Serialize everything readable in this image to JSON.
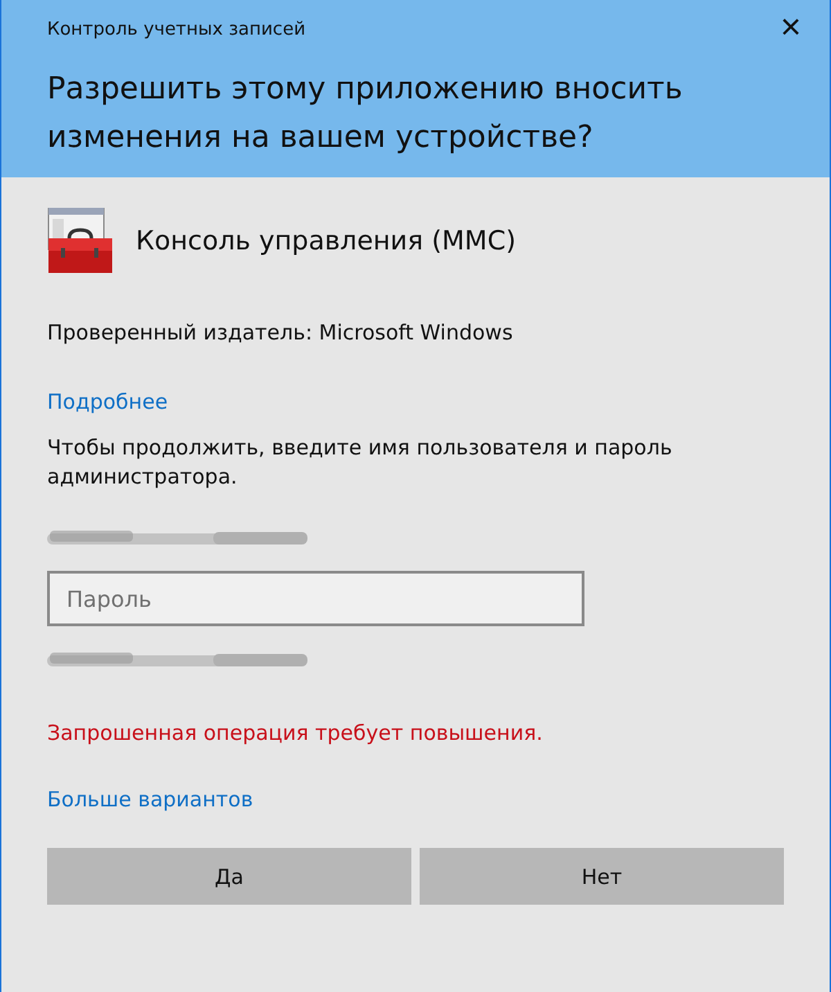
{
  "window": {
    "title": "Контроль учетных записей",
    "close": "×"
  },
  "heading": "Разрешить этому приложению вносить изменения на вашем устройстве?",
  "app": {
    "name": "Консоль управления (MMC)"
  },
  "publisher": "Проверенный издатель: Microsoft Windows",
  "details_link": "Подробнее",
  "instructions": "Чтобы продолжить, введите имя пользователя и пароль администратора.",
  "account_lines": [
    {
      "kind": "redacted"
    },
    {
      "kind": "redacted"
    }
  ],
  "password": {
    "placeholder": "Пароль"
  },
  "error": "Запрошенная операция требует повышения.",
  "more_link": "Больше вариантов",
  "buttons": [
    "Да",
    "Нет"
  ]
}
